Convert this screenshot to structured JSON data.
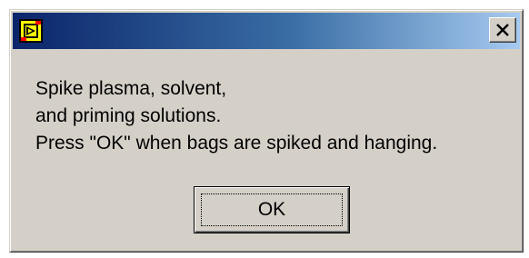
{
  "dialog": {
    "title": "",
    "app_icon": "labview-vi-icon",
    "close_label": "✕",
    "message_lines": [
      "Spike plasma, solvent,",
      "and priming solutions.",
      "Press \"OK\" when bags are spiked and hanging."
    ],
    "ok_label": "OK",
    "colors": {
      "titlebar_start": "#0a246a",
      "titlebar_end": "#a6caf0",
      "face": "#d4d0c8"
    }
  }
}
